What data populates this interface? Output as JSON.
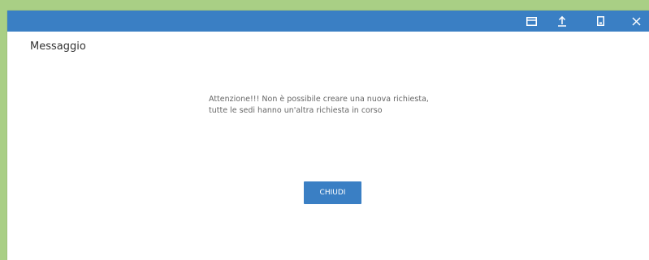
{
  "window": {
    "title": "Messaggio",
    "controls": [
      {
        "name": "restore-icon"
      },
      {
        "name": "upload-icon"
      },
      {
        "name": "mobile-icon"
      },
      {
        "name": "close-icon"
      }
    ]
  },
  "message": {
    "line1": "Attenzione!!! Non è possibile creare una nuova richiesta,",
    "line2": "tutte le sedi hanno un'altra richiesta in corso"
  },
  "actions": {
    "close_label": "CHIUDI"
  },
  "colors": {
    "accent": "#3a7fc4",
    "background": "#a9cf85",
    "text": "#333333",
    "message_text": "#666666"
  }
}
